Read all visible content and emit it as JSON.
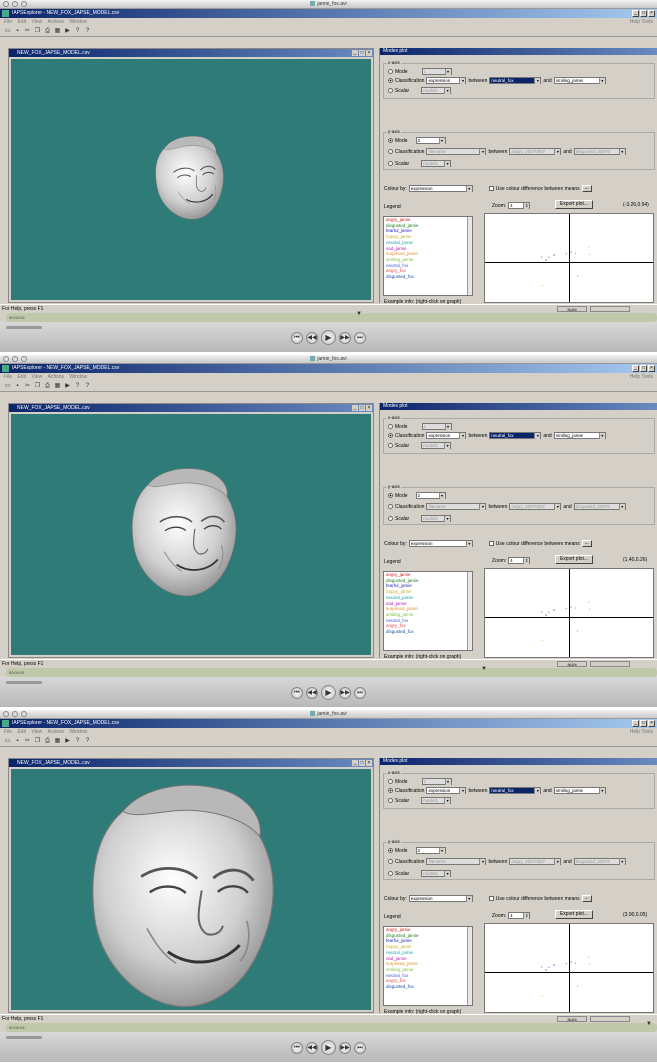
{
  "mac_title": "jamie_fox.avi",
  "app_title": "IAPSExplorer - NEW_FOX_JAPSE_MODEL.csv",
  "menu": [
    "File",
    "Edit",
    "View",
    "Actions",
    "Window"
  ],
  "menu_right": "Help  Tools",
  "viewer_title": "NEW_FOX_JAPSE_MODEL.csv",
  "plot_title": "Modes plot",
  "xaxis": {
    "group": "x-axis",
    "mode_label": "Mode",
    "mode_value": "1",
    "classification_label": "Classification",
    "classification_value": "expression",
    "between_label": "between",
    "between_value": "neutral_fox",
    "and_label": "and",
    "and_value": "smiling_jamie",
    "scalar_label": "Scalar",
    "scalar_value": "model1"
  },
  "yaxis": {
    "group": "y-axis",
    "mode_label": "Mode",
    "mode_value": "2",
    "classification_label": "Classification",
    "classification_value": "filename",
    "between_label": "between",
    "between_value": "angry_20070607",
    "and_label": "and",
    "and_value": "disgusted_20070",
    "scalar_label": "Scalar",
    "scalar_value": "model1"
  },
  "colour_by_label": "Colour by:",
  "colour_by_value": "expression",
  "colour_diff_label": "Use colour difference between means",
  "colour_diff_button": "...",
  "legend_label": "Legend",
  "zoom_label": "Zoom:",
  "zoom_value": "4",
  "export_button": "Export plot...",
  "legend": [
    {
      "name": "angry_jamie",
      "color": "#d02020"
    },
    {
      "name": "disgusted_jamie",
      "color": "#208020"
    },
    {
      "name": "fearful_jamie",
      "color": "#2020c0"
    },
    {
      "name": "happy_jamie",
      "color": "#d0b030"
    },
    {
      "name": "neutral_jamie",
      "color": "#20a0a0"
    },
    {
      "name": "sad_jamie",
      "color": "#c020c0"
    },
    {
      "name": "surprised_jamie",
      "color": "#e09030"
    },
    {
      "name": "smiling_jamie",
      "color": "#80c040"
    },
    {
      "name": "neutral_fox",
      "color": "#4060e0"
    },
    {
      "name": "angry_fox",
      "color": "#e05050"
    },
    {
      "name": "disgusted_fox",
      "color": "#2050a0"
    }
  ],
  "example_info": "Example info: (right-click on graph)",
  "status_help": "For Help, press F1",
  "status_num": "NUM",
  "frames": [
    {
      "coords": "(-3.26,0.94)",
      "timecode": "00:00:02"
    },
    {
      "coords": "(1.40,0.26)",
      "timecode": "00:00:01"
    },
    {
      "coords": "(3.90,0.05)",
      "timecode": "00:00:04"
    }
  ],
  "icons": {
    "play": "play-icon",
    "rewind": "rewind-icon",
    "forward": "fast-forward-icon",
    "prev": "previous-icon",
    "next": "next-icon"
  }
}
